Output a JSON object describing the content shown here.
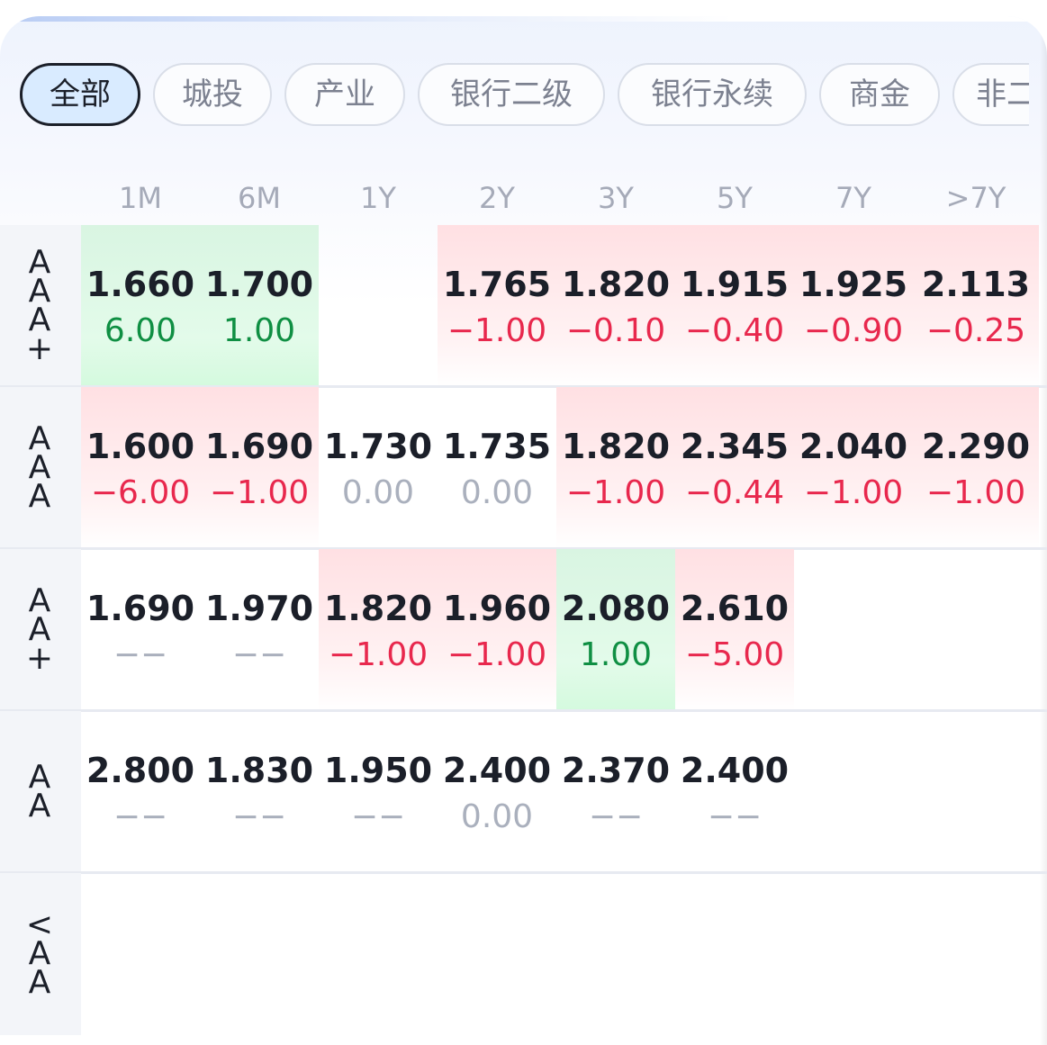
{
  "tabs": [
    {
      "label": "全部",
      "active": true
    },
    {
      "label": "城投",
      "active": false
    },
    {
      "label": "产业",
      "active": false
    },
    {
      "label": "银行二级",
      "active": false
    },
    {
      "label": "银行永续",
      "active": false
    },
    {
      "label": "商金",
      "active": false
    },
    {
      "label": "非二",
      "active": false
    }
  ],
  "columns": [
    "1M",
    "6M",
    "1Y",
    "2Y",
    "3Y",
    "5Y",
    "7Y",
    ">7Y"
  ],
  "colors": {
    "up_bg": "#ffe0e3",
    "down_bg": "#d9f5e2",
    "negative": "#e8284d",
    "positive": "#0f8f43",
    "muted": "#aab0bd"
  },
  "rows": [
    {
      "label_chars": [
        "A",
        "A",
        "A",
        "+"
      ],
      "cells": [
        {
          "value": "1.660",
          "change": "6.00",
          "tone": "pos"
        },
        {
          "value": "1.700",
          "change": "1.00",
          "tone": "pos"
        },
        {
          "value": "",
          "change": "",
          "tone": "empty"
        },
        {
          "value": "1.765",
          "change": "−1.00",
          "tone": "neg"
        },
        {
          "value": "1.820",
          "change": "−0.10",
          "tone": "neg"
        },
        {
          "value": "1.915",
          "change": "−0.40",
          "tone": "neg"
        },
        {
          "value": "1.925",
          "change": "−0.90",
          "tone": "neg"
        },
        {
          "value": "2.113",
          "change": "−0.25",
          "tone": "neg"
        }
      ]
    },
    {
      "label_chars": [
        "A",
        "A",
        "A"
      ],
      "cells": [
        {
          "value": "1.600",
          "change": "−6.00",
          "tone": "neg"
        },
        {
          "value": "1.690",
          "change": "−1.00",
          "tone": "neg"
        },
        {
          "value": "1.730",
          "change": "0.00",
          "tone": "zero"
        },
        {
          "value": "1.735",
          "change": "0.00",
          "tone": "zero"
        },
        {
          "value": "1.820",
          "change": "−1.00",
          "tone": "neg"
        },
        {
          "value": "2.345",
          "change": "−0.44",
          "tone": "neg"
        },
        {
          "value": "2.040",
          "change": "−1.00",
          "tone": "neg"
        },
        {
          "value": "2.290",
          "change": "−1.00",
          "tone": "neg"
        }
      ]
    },
    {
      "label_chars": [
        "A",
        "A",
        "+"
      ],
      "cells": [
        {
          "value": "1.690",
          "change": "−−",
          "tone": "na"
        },
        {
          "value": "1.970",
          "change": "−−",
          "tone": "na"
        },
        {
          "value": "1.820",
          "change": "−1.00",
          "tone": "neg"
        },
        {
          "value": "1.960",
          "change": "−1.00",
          "tone": "neg"
        },
        {
          "value": "2.080",
          "change": "1.00",
          "tone": "pos"
        },
        {
          "value": "2.610",
          "change": "−5.00",
          "tone": "neg"
        },
        {
          "value": "",
          "change": "",
          "tone": "empty"
        },
        {
          "value": "",
          "change": "",
          "tone": "empty"
        }
      ]
    },
    {
      "label_chars": [
        "A",
        "A"
      ],
      "cells": [
        {
          "value": "2.800",
          "change": "−−",
          "tone": "na"
        },
        {
          "value": "1.830",
          "change": "−−",
          "tone": "na"
        },
        {
          "value": "1.950",
          "change": "−−",
          "tone": "na"
        },
        {
          "value": "2.400",
          "change": "0.00",
          "tone": "zero"
        },
        {
          "value": "2.370",
          "change": "−−",
          "tone": "na"
        },
        {
          "value": "2.400",
          "change": "−−",
          "tone": "na"
        },
        {
          "value": "",
          "change": "",
          "tone": "empty"
        },
        {
          "value": "",
          "change": "",
          "tone": "empty"
        }
      ]
    },
    {
      "label_chars": [
        "<",
        "A",
        "A"
      ],
      "cells": [
        {
          "value": "",
          "change": "",
          "tone": "empty"
        },
        {
          "value": "",
          "change": "",
          "tone": "empty"
        },
        {
          "value": "",
          "change": "",
          "tone": "empty"
        },
        {
          "value": "",
          "change": "",
          "tone": "empty"
        },
        {
          "value": "",
          "change": "",
          "tone": "empty"
        },
        {
          "value": "",
          "change": "",
          "tone": "empty"
        },
        {
          "value": "",
          "change": "",
          "tone": "empty"
        },
        {
          "value": "",
          "change": "",
          "tone": "empty"
        }
      ]
    }
  ]
}
